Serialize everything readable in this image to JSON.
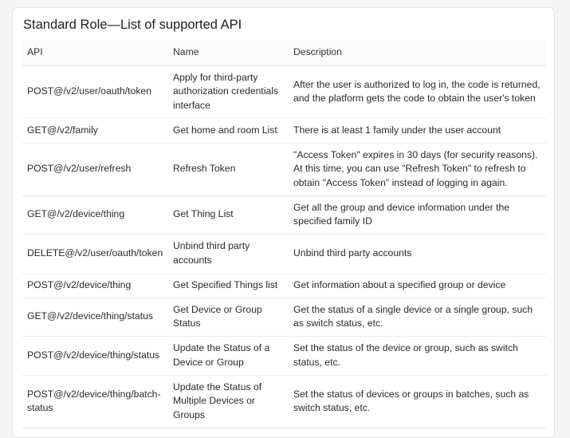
{
  "section": {
    "title": "Standard Role—List of supported API"
  },
  "table": {
    "headers": [
      "API",
      "Name",
      "Description"
    ],
    "rows": [
      {
        "api": "POST@/v2/user/oauth/token",
        "name": "Apply for third-party authorization credentials interface",
        "description": "After the user is authorized to log in, the code is returned, and the platform gets the code to obtain the user's token"
      },
      {
        "api": "GET@/v2/family",
        "name": "Get home and room List",
        "description": "There is at least 1 family under the user account"
      },
      {
        "api": "POST@/v2/user/refresh",
        "name": "Refresh Token",
        "description": "\"Access Token\" expires in 30 days (for security reasons). At this time, you can use \"Refresh Token\" to refresh to obtain \"Access Token\" instead of logging in again."
      },
      {
        "api": "GET@/v2/device/thing",
        "name": "Get Thing List",
        "description": "Get all the group and device information under the specified family ID"
      },
      {
        "api": "DELETE@/v2/user/oauth/token",
        "name": "Unbind third party accounts",
        "description": "Unbind third party accounts"
      },
      {
        "api": "POST@/v2/device/thing",
        "name": "Get Specified Things list",
        "description": "Get information about a specified group or device"
      },
      {
        "api": "GET@/v2/device/thing/status",
        "name": "Get Device or Group Status",
        "description": "Get the status of a single device or a single group, such as switch status, etc."
      },
      {
        "api": "POST@/v2/device/thing/status",
        "name": "Update the Status of a Device or Group",
        "description": "Set the status of the device or group, such as switch status, etc."
      },
      {
        "api": "POST@/v2/device/thing/batch-status",
        "name": "Update the Status of Multiple Devices or Groups",
        "description": "Set the status of devices or groups in batches, such as switch status, etc."
      }
    ]
  }
}
